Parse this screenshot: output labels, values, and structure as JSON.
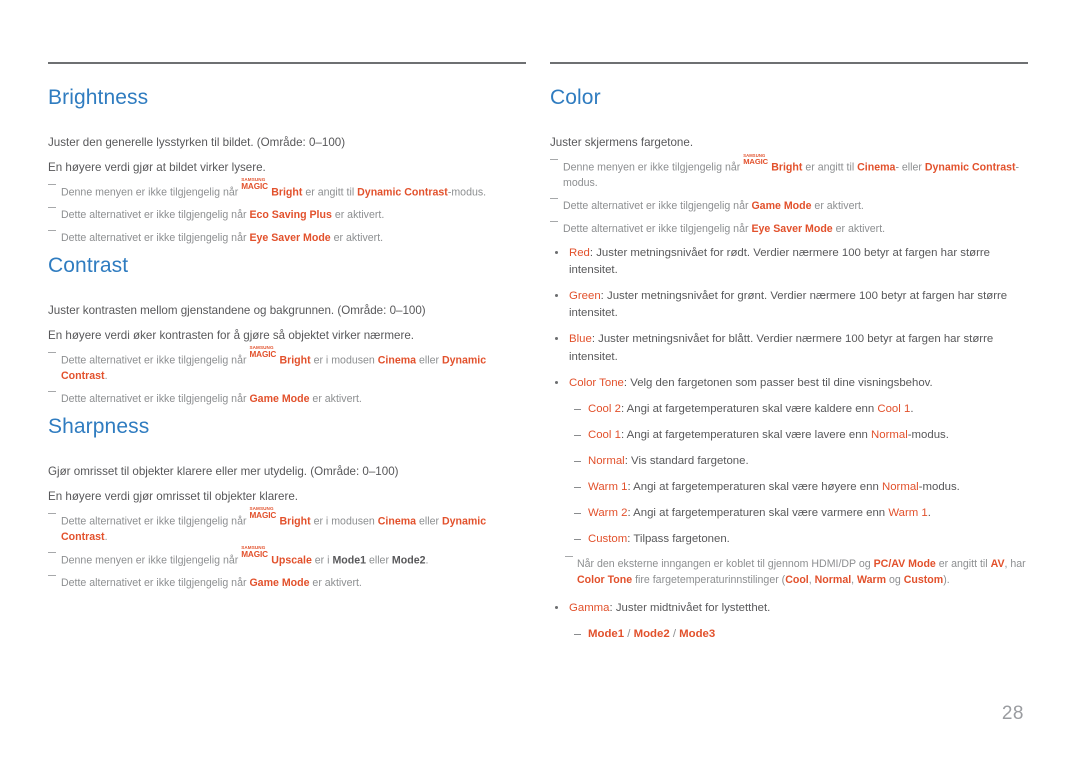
{
  "page": {
    "number": "28",
    "accent_color": "#e2512c",
    "heading_color": "#2f7cc0",
    "body_color": "#58585a",
    "note_color": "#8d8f91",
    "rule_color": "#6e7072"
  },
  "logo": {
    "line1": "SAMSUNG",
    "line2": "MAGIC"
  },
  "left": {
    "brightness": {
      "title": "Brightness",
      "lines": [
        "Juster den generelle lysstyrken til bildet. (Område: 0–100)",
        "En høyere verdi gjør at bildet virker lysere."
      ],
      "notes": [
        {
          "pre": "Denne menyen er ikke tilgjengelig når ",
          "logo": true,
          "term1": "Bright",
          "mid": " er angitt til ",
          "term2": "Dynamic Contrast",
          "post": "-modus."
        },
        {
          "pre": "Dette alternativet er ikke tilgjengelig når ",
          "term1": "Eco Saving Plus",
          "post": " er aktivert."
        },
        {
          "pre": "Dette alternativet er ikke tilgjengelig når ",
          "term1": "Eye Saver Mode",
          "post": " er aktivert."
        }
      ]
    },
    "contrast": {
      "title": "Contrast",
      "lines": [
        "Juster kontrasten mellom gjenstandene og bakgrunnen. (Område: 0–100)",
        "En høyere verdi øker kontrasten for å gjøre så objektet virker nærmere."
      ],
      "notes": [
        {
          "pre": "Dette alternativet er ikke tilgjengelig når ",
          "logo": true,
          "term1": "Bright",
          "mid": " er i modusen ",
          "term2": "Cinema",
          "mid2": " eller ",
          "term3": "Dynamic Contrast",
          "post": "."
        },
        {
          "pre": "Dette alternativet er ikke tilgjengelig når ",
          "term1": "Game Mode",
          "post": " er aktivert."
        }
      ]
    },
    "sharpness": {
      "title": "Sharpness",
      "lines": [
        "Gjør omrisset til objekter klarere eller mer utydelig. (Område: 0–100)",
        "En høyere verdi gjør omrisset til objekter klarere."
      ],
      "notes": [
        {
          "pre": "Dette alternativet er ikke tilgjengelig når ",
          "logo": true,
          "term1": "Bright",
          "mid": " er i modusen ",
          "term2": "Cinema",
          "mid2": " eller ",
          "term3": "Dynamic Contrast",
          "post": "."
        },
        {
          "pre": "Denne menyen er ikke tilgjengelig når ",
          "logo": true,
          "term1": "Upscale",
          "mid": " er i ",
          "term2": "Mode1",
          "mid2": " eller ",
          "term3": "Mode2",
          "post": "."
        },
        {
          "pre": "Dette alternativet er ikke tilgjengelig når ",
          "term1": "Game Mode",
          "post": " er aktivert."
        }
      ]
    }
  },
  "right": {
    "color": {
      "title": "Color",
      "lines": [
        "Juster skjermens fargetone."
      ],
      "notes": [
        {
          "pre": "Denne menyen er ikke tilgjengelig når ",
          "logo": true,
          "term1": "Bright",
          "mid": " er angitt til ",
          "term2": "Cinema",
          "mid2": "- eller ",
          "term3": "Dynamic Contrast",
          "post": "-modus."
        },
        {
          "pre": "Dette alternativet er ikke tilgjengelig når ",
          "term1": "Game Mode",
          "post": " er aktivert."
        },
        {
          "pre": "Dette alternativet er ikke tilgjengelig når ",
          "term1": "Eye Saver Mode",
          "post": " er aktivert."
        }
      ],
      "bullets": [
        {
          "term": "Red",
          "text": ": Juster metningsnivået for rødt. Verdier nærmere 100 betyr at fargen har større intensitet."
        },
        {
          "term": "Green",
          "text": ": Juster metningsnivået for grønt. Verdier nærmere 100 betyr at fargen har større intensitet."
        },
        {
          "term": "Blue",
          "text": ": Juster metningsnivået for blått. Verdier nærmere 100 betyr at fargen har større intensitet."
        },
        {
          "term": "Color Tone",
          "text": ": Velg den fargetonen som passer best til dine visningsbehov."
        }
      ],
      "color_tone_options": [
        {
          "term": "Cool 2",
          "pre": ": Angi at fargetemperaturen skal være kaldere enn ",
          "ref": "Cool 1",
          "post": "."
        },
        {
          "term": "Cool 1",
          "pre": ": Angi at fargetemperaturen skal være lavere enn ",
          "ref": "Normal",
          "post": "-modus."
        },
        {
          "term": "Normal",
          "pre": ": Vis standard fargetone.",
          "ref": "",
          "post": ""
        },
        {
          "term": "Warm 1",
          "pre": ": Angi at fargetemperaturen skal være høyere enn ",
          "ref": "Normal",
          "post": "-modus."
        },
        {
          "term": "Warm 2",
          "pre": ": Angi at fargetemperaturen skal være varmere enn ",
          "ref": "Warm 1",
          "post": "."
        },
        {
          "term": "Custom",
          "pre": ": Tilpass fargetonen.",
          "ref": "",
          "post": ""
        }
      ],
      "external_note": {
        "p1": "Når den eksterne inngangen er koblet til gjennom HDMI/DP og ",
        "t1": "PC/AV Mode",
        "p2": " er angitt til ",
        "t2": "AV",
        "p3": ", har ",
        "t3": "Color Tone",
        "p4": " fire fargetemperaturinnstilinger (",
        "t4": "Cool",
        "p5": ", ",
        "t5": "Normal",
        "p6": ", ",
        "t6": "Warm",
        "p7": " og ",
        "t7": "Custom",
        "p8": ")."
      },
      "gamma": {
        "term": "Gamma",
        "text": ": Juster midtnivået for lystetthet.",
        "modes": [
          "Mode1",
          "Mode2",
          "Mode3"
        ],
        "separator": " / "
      }
    }
  }
}
